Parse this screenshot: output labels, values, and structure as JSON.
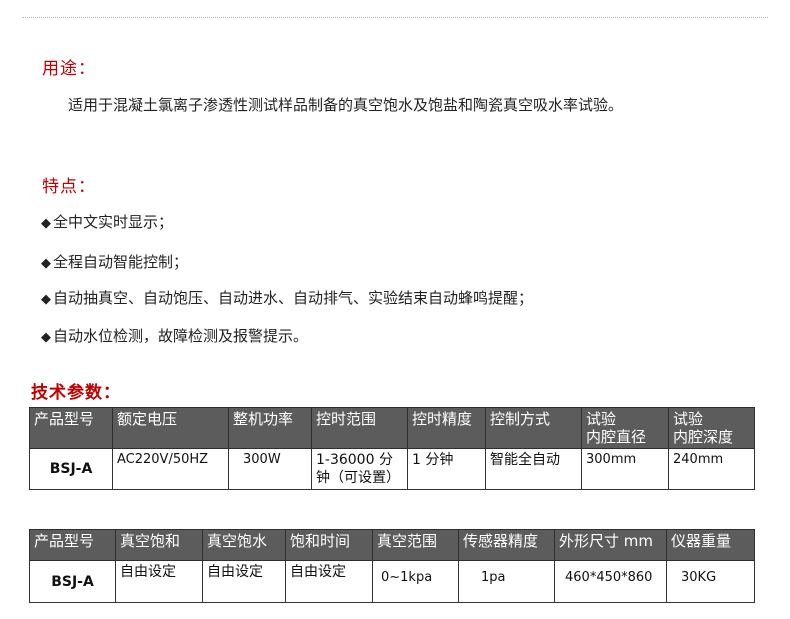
{
  "usage": {
    "heading": "用途：",
    "text": "适用于混凝土氯离子渗透性测试样品制备的真空饱水及饱盐和陶瓷真空吸水率试验。"
  },
  "features": {
    "heading": "特点：",
    "bullet": "◆",
    "items": [
      "全中文实时显示；",
      "全程自动智能控制；",
      "自动抽真空、自动饱压、自动进水、自动排气、实验结束自动蜂鸣提醒；",
      "自动水位检测，故障检测及报警提示。"
    ]
  },
  "params": {
    "heading": "技术参数：",
    "table1": {
      "headers": [
        "产品型号",
        "额定电压",
        "整机功率",
        "控时范围",
        "控时精度",
        "控制方式",
        "试验\n内腔直径",
        "试验\n内腔深度"
      ],
      "row": [
        "BSJ-A",
        "AC220V/50HZ",
        "300W",
        "1-36000  分\n钟（可设置）",
        "1 分钟",
        "智能全自动",
        "300mm",
        "240mm"
      ]
    },
    "table2": {
      "headers": [
        "产品型号",
        "真空饱和",
        "真空饱水",
        "饱和时间",
        "真空范围",
        "传感器精度",
        "外形尺寸 mm",
        "仪器重量"
      ],
      "row": [
        "BSJ-A",
        "自由设定",
        "自由设定",
        "自由设定",
        "0~1kpa",
        "1pa",
        "460*450*860",
        "30KG"
      ]
    }
  }
}
